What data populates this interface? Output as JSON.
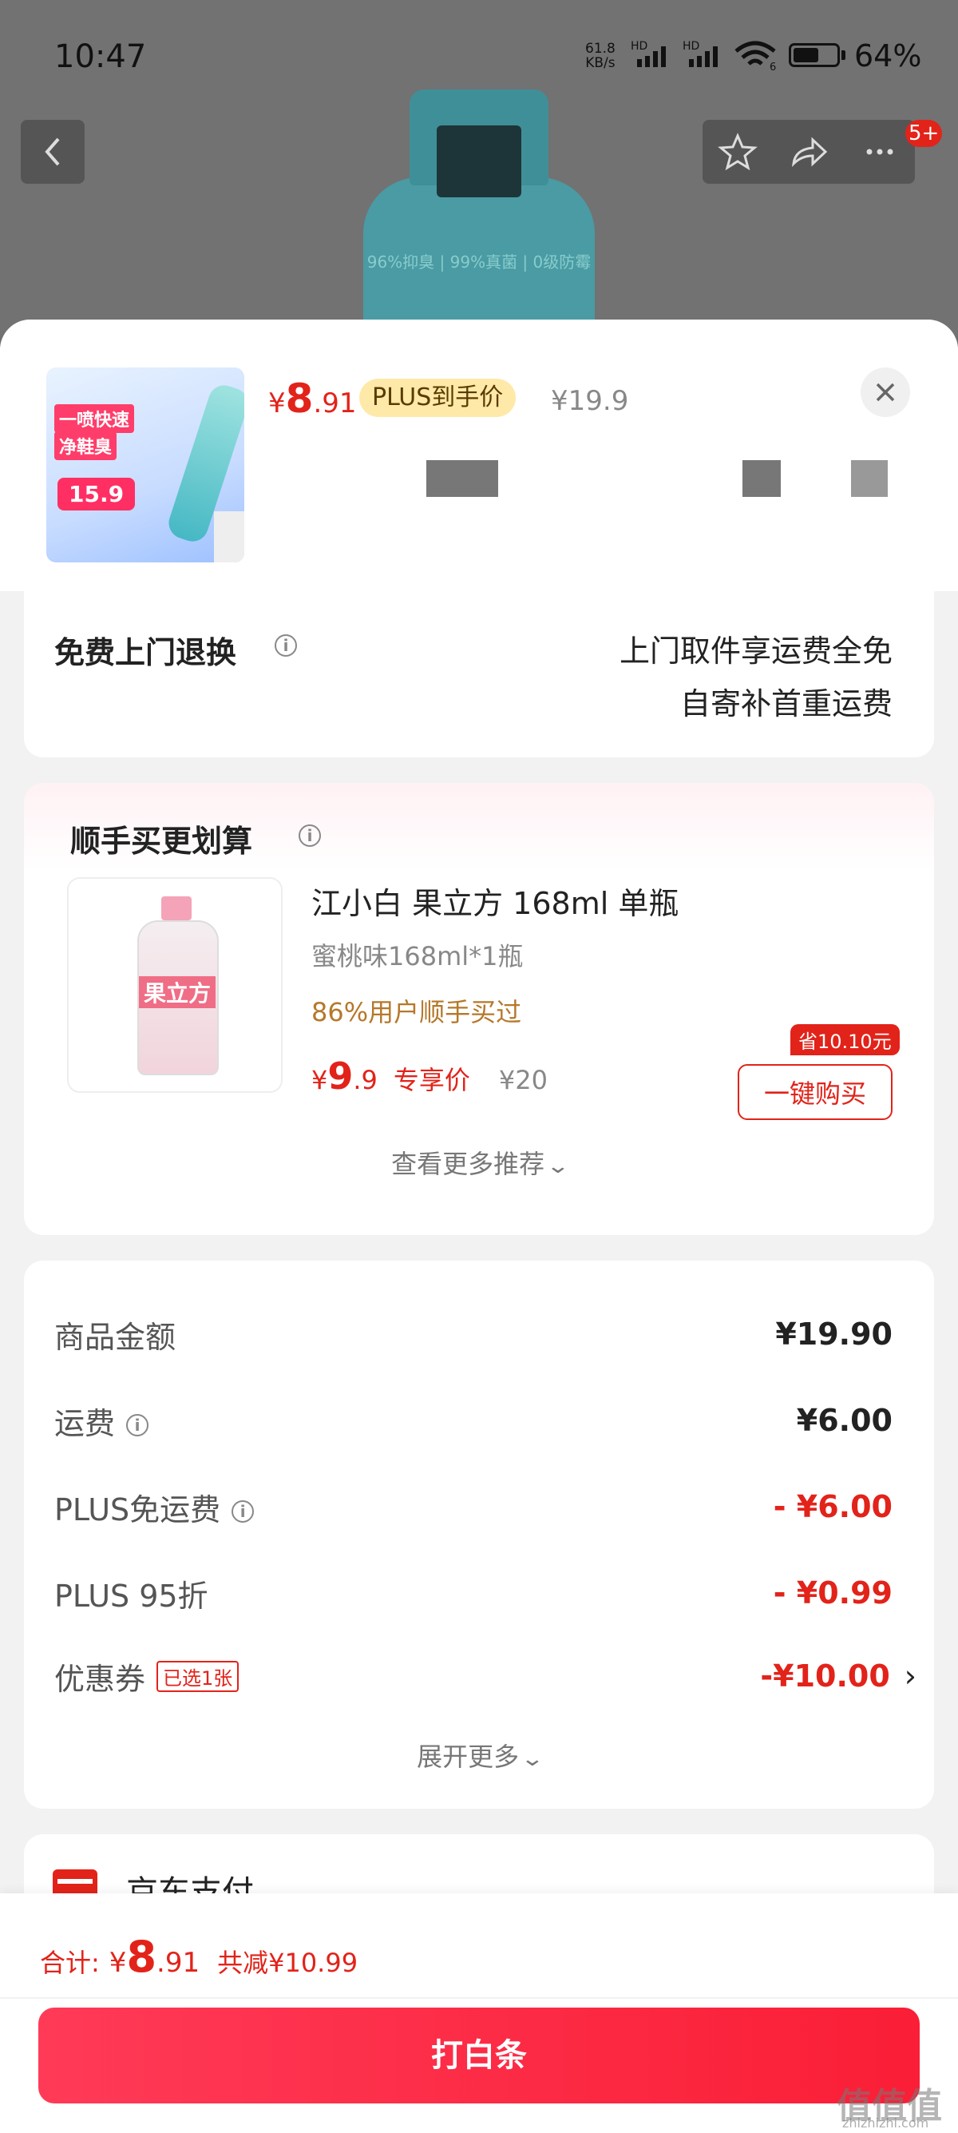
{
  "status_bar": {
    "time": "10:47",
    "net_speed_value": "61.8",
    "net_speed_unit": "KB/s",
    "hd1": "HD",
    "hd2": "HD",
    "wifi_badge": "6",
    "battery_percent": "64%",
    "battery_level": 0.64
  },
  "nav": {
    "cart_badge": "5+",
    "product_image_text": "96%抑臭 | 99%真菌 | 0级防霉"
  },
  "product": {
    "thumb_line1": "一喷快速",
    "thumb_line2": "净鞋臭",
    "thumb_price": "15.9",
    "price_currency": "¥",
    "price_int": "8",
    "price_dec": ".91",
    "plus_label": "PLUS到手价",
    "original_price": "¥19.9"
  },
  "return_service": {
    "title": "免费上门退换",
    "line1": "上门取件享运费全免",
    "line2": "自寄补首重运费"
  },
  "recommend": {
    "title": "顺手买更划算",
    "item": {
      "label_text": "果立方",
      "name": "江小白 果立方 168ml 单瓶",
      "spec": "蜜桃味168ml*1瓶",
      "social": "86%用户顺手买过",
      "price_currency": "¥",
      "price_int": "9",
      "price_dec": ".9",
      "price_tag": "专享价",
      "original_price": "¥20",
      "save_tag": "省10.10元",
      "buy_label": "一键购买"
    },
    "more_label": "查看更多推荐"
  },
  "costs": {
    "rows": [
      {
        "label": "商品金额",
        "value": "¥19.90"
      },
      {
        "label": "运费",
        "value": "¥6.00"
      },
      {
        "label": "PLUS免运费",
        "value": "- ¥6.00"
      },
      {
        "label": "PLUS 95折",
        "value": "- ¥0.99"
      },
      {
        "label": "优惠券",
        "badge": "已选1张",
        "value": "-¥10.00",
        "arrow": "›"
      }
    ],
    "expand_label": "展开更多"
  },
  "payment": {
    "method_label": "京东支付"
  },
  "footer": {
    "total_label": "合计:",
    "total_currency": "¥",
    "total_int": "8",
    "total_dec": ".91",
    "total_saved": "共减¥10.99",
    "pay_button": "打白条"
  },
  "watermark": {
    "text": "值值值",
    "sub": "zhizhizhi.com"
  },
  "colors": {
    "accent_red": "#e2231a",
    "plus_gold": "#ffe9a8",
    "social_orange": "#b5782a"
  }
}
